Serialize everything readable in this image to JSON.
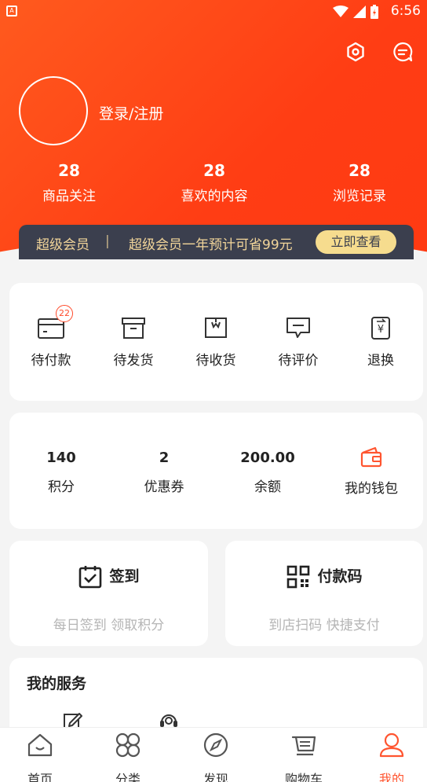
{
  "status_bar": {
    "time": "6:56",
    "left_icon_letter": "A"
  },
  "profile": {
    "login_label": "登录/注册"
  },
  "stats": [
    {
      "value": "28",
      "label": "商品关注"
    },
    {
      "value": "28",
      "label": "喜欢的内容"
    },
    {
      "value": "28",
      "label": "浏览记录"
    }
  ],
  "vip": {
    "title": "超级会员",
    "separator": "|",
    "text": "超级会员一年预计可省99元",
    "button": "立即查看"
  },
  "orders": {
    "items": [
      {
        "label": "待付款",
        "icon": "wallet-card-icon",
        "badge": "22"
      },
      {
        "label": "待发货",
        "icon": "box-icon"
      },
      {
        "label": "待收货",
        "icon": "package-icon"
      },
      {
        "label": "待评价",
        "icon": "comment-icon"
      },
      {
        "label": "退换",
        "icon": "exchange-icon"
      }
    ]
  },
  "assets": [
    {
      "value": "140",
      "label": "积分"
    },
    {
      "value": "2",
      "label": "优惠券"
    },
    {
      "value": "200.00",
      "label": "余额"
    }
  ],
  "wallet": {
    "label": "我的钱包",
    "icon": "wallet-icon"
  },
  "checkin": {
    "title": "签到",
    "subtitle": "每日签到 领取积分",
    "icon": "calendar-check-icon"
  },
  "paycode": {
    "title": "付款码",
    "subtitle": "到店扫码 快捷支付",
    "icon": "qr-code-icon"
  },
  "services": {
    "title": "我的服务"
  },
  "tabs": [
    {
      "label": "首页",
      "icon": "home-icon"
    },
    {
      "label": "分类",
      "icon": "category-icon"
    },
    {
      "label": "发现",
      "icon": "compass-icon"
    },
    {
      "label": "购物车",
      "icon": "cart-icon"
    },
    {
      "label": "我的",
      "icon": "user-icon"
    }
  ],
  "colors": {
    "brand": "#ff4a1c",
    "vip_bg": "#3b3f4e",
    "vip_text": "#f2d59a",
    "vip_button": "#f6dc8e",
    "active_tab": "#ff5530",
    "wallet_icon": "#ff5530"
  }
}
